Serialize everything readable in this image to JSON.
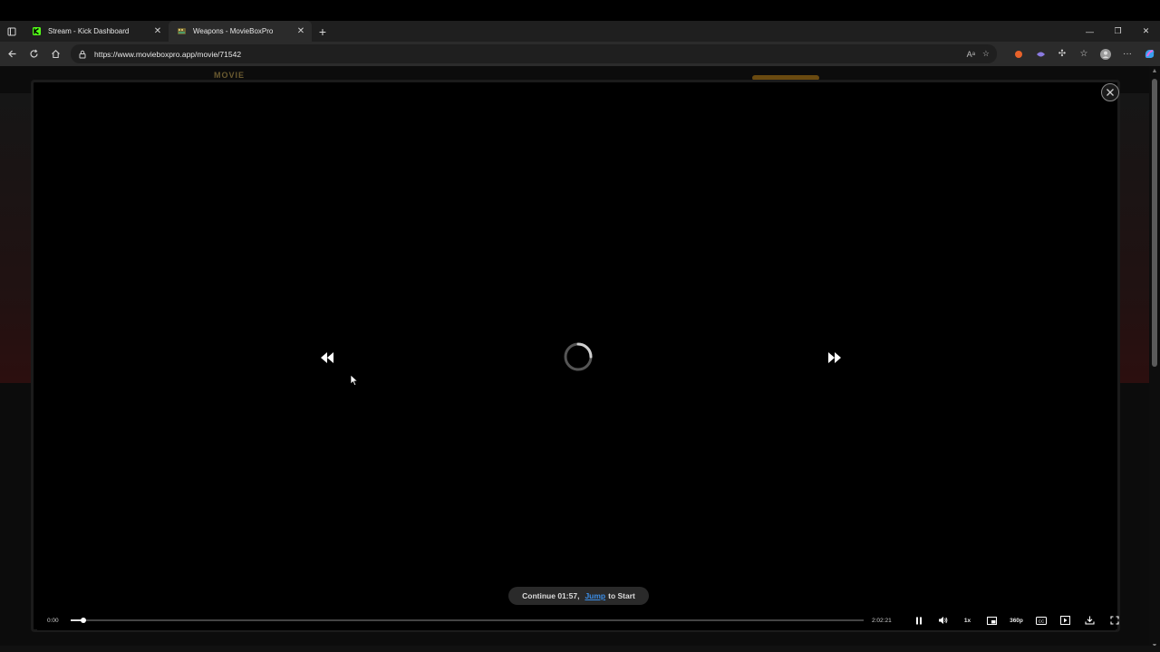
{
  "browser": {
    "tabs": [
      {
        "label": "Stream - Kick Dashboard",
        "favicon_color": "#53fc18",
        "active": false
      },
      {
        "label": "Weapons - MovieBoxPro",
        "favicon_color": "#b8a050",
        "active": true
      }
    ],
    "new_tab": "+",
    "url": "https://www.movieboxpro.app/movie/71542"
  },
  "site": {
    "logo_text": "MOVIE"
  },
  "player": {
    "current_time": "0:00",
    "duration": "2:02:21",
    "progress_fraction": 0.016,
    "continue_text": "Continue 01:57,",
    "jump_label": "Jump",
    "to_start_label": "to Start",
    "speed_label": "1x",
    "quality_label": "360p",
    "cc_label": "CC"
  },
  "colors": {
    "link_blue": "#3b8ee8",
    "kick_green": "#53fc18"
  }
}
